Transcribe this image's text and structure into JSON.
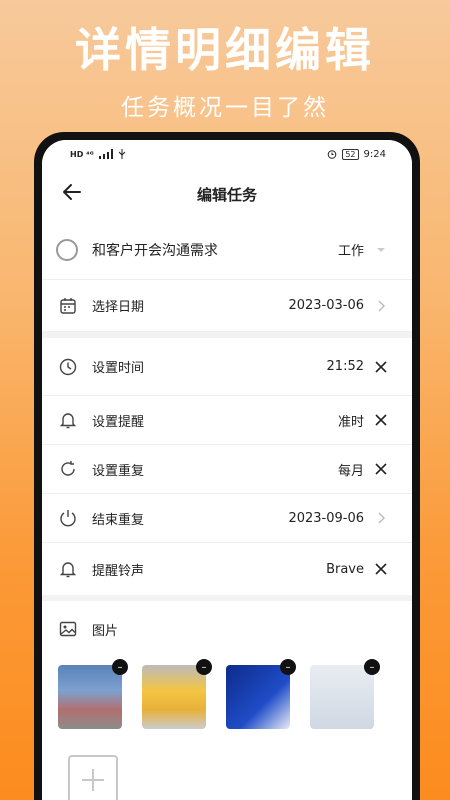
{
  "promo": {
    "title": "详情明细编辑",
    "subtitle": "任务概况一目了然"
  },
  "status_bar": {
    "left": "HD ⁴ᴳ",
    "battery": "52",
    "time": "9:24"
  },
  "header": {
    "title": "编辑任务"
  },
  "task": {
    "name": "和客户开会沟通需求",
    "category": "工作"
  },
  "rows": {
    "date": {
      "label": "选择日期",
      "value": "2023-03-06"
    },
    "time": {
      "label": "设置时间",
      "value": "21:52"
    },
    "reminder": {
      "label": "设置提醒",
      "value": "准时"
    },
    "repeat": {
      "label": "设置重复",
      "value": "每月"
    },
    "end_repeat": {
      "label": "结束重复",
      "value": "2023-09-06"
    },
    "ringtone": {
      "label": "提醒铃声",
      "value": "Brave"
    }
  },
  "pictures": {
    "label": "图片"
  },
  "colors": {
    "accent_orange": "#fc8c1e",
    "text": "#222222",
    "icon_gray": "#999999"
  }
}
